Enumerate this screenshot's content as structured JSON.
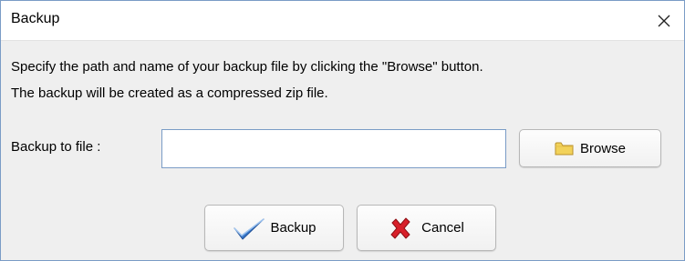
{
  "window": {
    "title": "Backup",
    "close_icon": "close-icon"
  },
  "description": {
    "line1": "Specify the path and name of your backup file by clicking the \"Browse\" button.",
    "line2": "The backup will be created as a compressed zip file."
  },
  "backup_field": {
    "label": "Backup to file :",
    "value": "",
    "placeholder": ""
  },
  "buttons": {
    "browse": {
      "label": "Browse",
      "icon": "folder-icon"
    },
    "backup": {
      "label": "Backup",
      "icon": "checkmark-icon"
    },
    "cancel": {
      "label": "Cancel",
      "icon": "x-icon"
    }
  },
  "colors": {
    "window_border": "#7a9cc6",
    "background": "#efefef",
    "check_blue": "#3a78c9",
    "cancel_red": "#d8202a",
    "folder_yellow": "#f2d25a"
  }
}
